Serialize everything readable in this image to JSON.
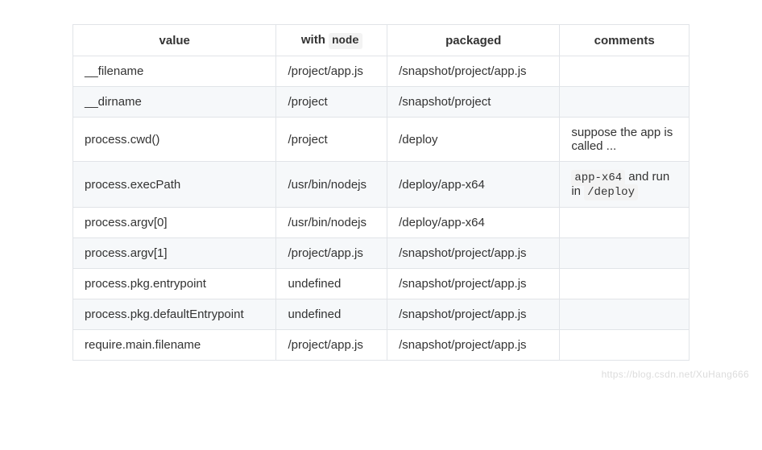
{
  "table": {
    "headers": {
      "value": "value",
      "with_pre": "with ",
      "with_code": "node",
      "packaged": "packaged",
      "comments": "comments"
    },
    "rows": [
      {
        "value": "__filename",
        "node": "/project/app.js",
        "packaged": "/snapshot/project/app.js",
        "comments": ""
      },
      {
        "value": "__dirname",
        "node": "/project",
        "packaged": "/snapshot/project",
        "comments": ""
      },
      {
        "value": "process.cwd()",
        "node": "/project",
        "packaged": "/deploy",
        "comments": "suppose the app is called ..."
      },
      {
        "value": "process.execPath",
        "node": "/usr/bin/nodejs",
        "packaged": "/deploy/app-x64",
        "comments_parts": {
          "code1": "app-x64",
          "mid": " and run in ",
          "code2": "/deploy"
        }
      },
      {
        "value": "process.argv[0]",
        "node": "/usr/bin/nodejs",
        "packaged": "/deploy/app-x64",
        "comments": ""
      },
      {
        "value": "process.argv[1]",
        "node": "/project/app.js",
        "packaged": "/snapshot/project/app.js",
        "comments": ""
      },
      {
        "value": "process.pkg.entrypoint",
        "node": "undefined",
        "packaged": "/snapshot/project/app.js",
        "comments": ""
      },
      {
        "value": "process.pkg.defaultEntrypoint",
        "node": "undefined",
        "packaged": "/snapshot/project/app.js",
        "comments": ""
      },
      {
        "value": "require.main.filename",
        "node": "/project/app.js",
        "packaged": "/snapshot/project/app.js",
        "comments": ""
      }
    ]
  },
  "watermark": "https://blog.csdn.net/XuHang666"
}
